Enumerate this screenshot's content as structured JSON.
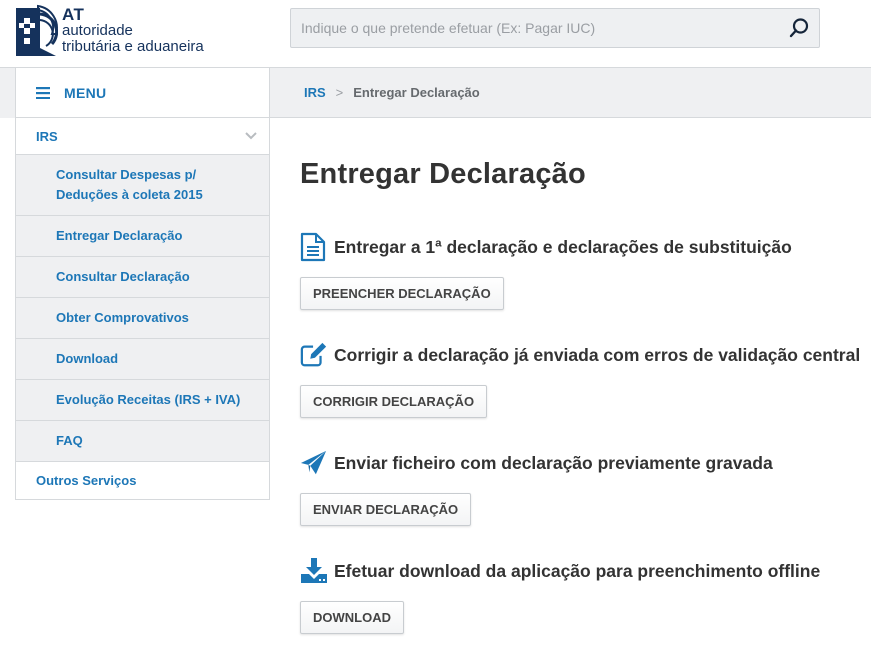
{
  "header": {
    "logo": {
      "acronym": "AT",
      "line1": "autoridade",
      "line2": "tributária e aduaneira"
    },
    "search": {
      "placeholder": "Indique o que pretende efetuar (Ex: Pagar IUC)",
      "value": "",
      "icon": "search-icon"
    }
  },
  "menu": {
    "label": "MENU",
    "icon": "hamburger-icon"
  },
  "breadcrumb": {
    "items": [
      "IRS",
      "Entregar Declaração"
    ],
    "separator": ">"
  },
  "sidebar": {
    "section": {
      "label": "IRS",
      "icon": "chevron-down-icon",
      "expanded": true
    },
    "items": [
      {
        "label": "Consultar Despesas p/ Deduções à coleta 2015"
      },
      {
        "label": "Entregar Declaração"
      },
      {
        "label": "Consultar Declaração"
      },
      {
        "label": "Obter Comprovativos"
      },
      {
        "label": "Download"
      },
      {
        "label": "Evolução Receitas (IRS + IVA)"
      },
      {
        "label": "FAQ"
      }
    ],
    "other": {
      "label": "Outros Serviços"
    }
  },
  "main": {
    "title": "Entregar Declaração",
    "sections": [
      {
        "icon": "document-icon",
        "title": "Entregar a 1ª declaração e declarações de substituição",
        "button": "PREENCHER DECLARAÇÃO"
      },
      {
        "icon": "edit-icon",
        "title": "Corrigir a declaração já enviada com erros de validação central",
        "button": "CORRIGIR DECLARAÇÃO"
      },
      {
        "icon": "paper-plane-icon",
        "title": "Enviar ficheiro com declaração previamente gravada",
        "button": "ENVIAR DECLARAÇÃO"
      },
      {
        "icon": "download-icon",
        "title": "Efetuar download da aplicação para preenchimento offline",
        "button": "DOWNLOAD"
      }
    ]
  },
  "colors": {
    "accent": "#1d77b7",
    "logo": "#15325c",
    "bar_bg": "#eff0f2",
    "border": "#d6d9dc",
    "text": "#333333"
  }
}
